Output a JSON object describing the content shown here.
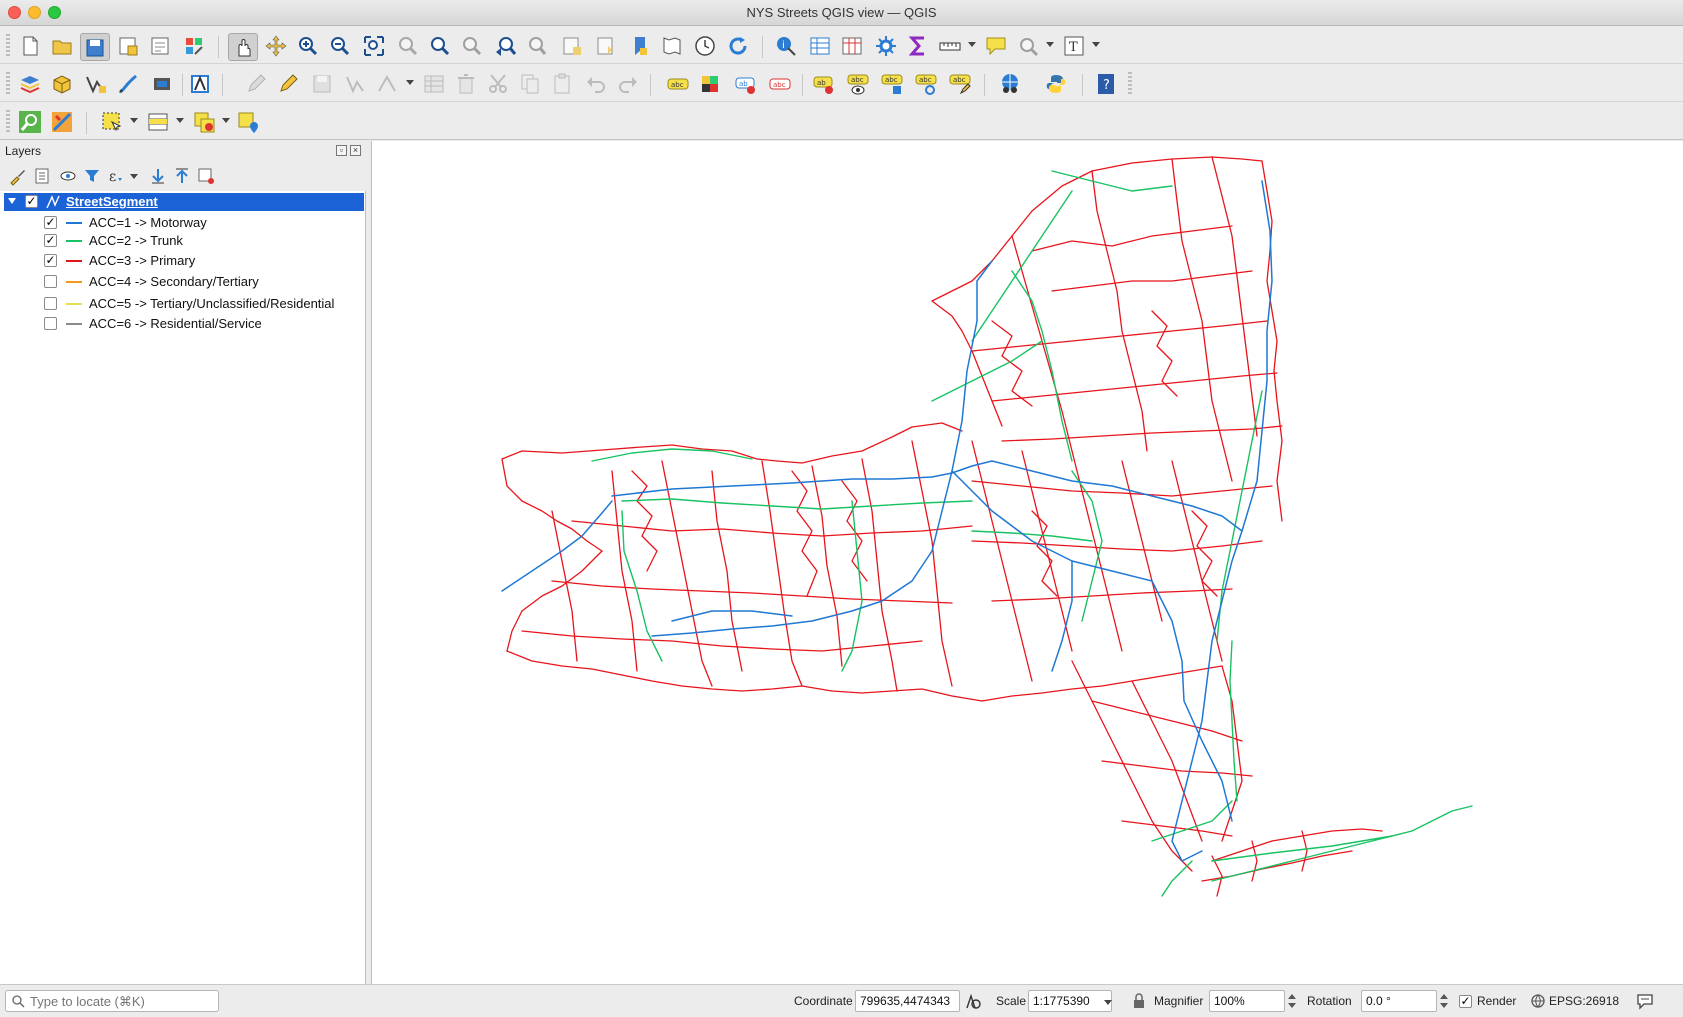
{
  "window": {
    "title": "NYS Streets QGIS view — QGIS"
  },
  "toolbars": {
    "row1": [
      "new-project",
      "open-project",
      "save-project",
      "save-as",
      "print-layout",
      "style-manager",
      "pan",
      "pan-to-selection",
      "zoom-in",
      "zoom-out",
      "zoom-full",
      "zoom-to-selection",
      "zoom-to-layer",
      "zoom-native",
      "zoom-last",
      "zoom-next",
      "new-bookmark",
      "show-bookmarks",
      "temporal-controller",
      "refresh",
      "identify",
      "open-attribute-table",
      "open-field-calculator",
      "processing-toolbox",
      "statistical-summary",
      "measure",
      "map-tips",
      "annotation",
      "text-annotation"
    ],
    "row2": [
      "data-source-manager",
      "new-geopackage-layer",
      "new-shapefile-layer",
      "new-spatialite-layer",
      "new-virtual-layer",
      "current-edits",
      "toggle-editing",
      "save-layer-edits",
      "digitize",
      "vertex-tool",
      "delete-selected",
      "cut",
      "copy",
      "paste",
      "undo",
      "redo",
      "label-tool",
      "diagram",
      "pin-label",
      "show-hide-labels",
      "move-label",
      "rotate-label",
      "change-label",
      "plugins",
      "python-console",
      "help"
    ],
    "row3": [
      "locator",
      "identify-features",
      "select-features",
      "select-by-value",
      "deselect",
      "select-location"
    ]
  },
  "layers_panel": {
    "title": "Layers",
    "layer": {
      "name": "StreetSegment",
      "checked": true
    },
    "categories": [
      {
        "label": "ACC=1 -> Motorway",
        "color": "#1f78d4",
        "checked": true
      },
      {
        "label": "ACC=2 -> Trunk",
        "color": "#18c262",
        "checked": true
      },
      {
        "label": "ACC=3 -> Primary",
        "color": "#e8141b",
        "checked": true
      },
      {
        "label": "ACC=4 -> Secondary/Tertiary",
        "color": "#f39a1d",
        "checked": false
      },
      {
        "label": "ACC=5 -> Tertiary/Unclassified/Residential",
        "color": "#e8e04a",
        "checked": false
      },
      {
        "label": "ACC=6 -> Residential/Service",
        "color": "#8a8a8a",
        "checked": false
      }
    ]
  },
  "statusbar": {
    "locate_placeholder": "Type to locate (⌘K)",
    "coordinate_label": "Coordinate",
    "coordinate_value": "799635,4474343",
    "scale_label": "Scale",
    "scale_value": "1:1775390",
    "magnifier_label": "Magnifier",
    "magnifier_value": "100%",
    "rotation_label": "Rotation",
    "rotation_value": "0.0 °",
    "render_label": "Render",
    "render_checked": true,
    "crs_label": "EPSG:26918"
  }
}
